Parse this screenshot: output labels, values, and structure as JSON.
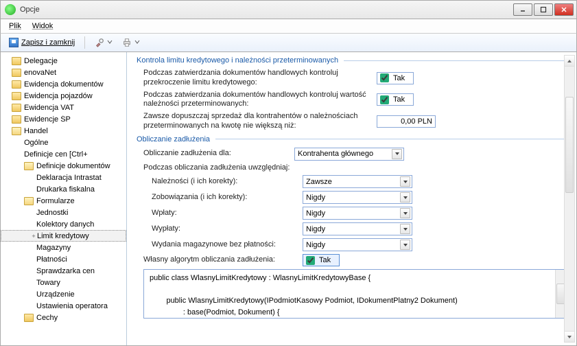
{
  "window": {
    "title": "Opcje"
  },
  "menu": {
    "file": "Plik",
    "view": "Widok"
  },
  "toolbar": {
    "save_close": "Zapisz i zamknij"
  },
  "tree": [
    {
      "label": "Delegacje",
      "depth": 0,
      "folder": true
    },
    {
      "label": "enovaNet",
      "depth": 0,
      "folder": true
    },
    {
      "label": "Ewidencja dokumentów",
      "depth": 0,
      "folder": true
    },
    {
      "label": "Ewidencja pojazdów",
      "depth": 0,
      "folder": true
    },
    {
      "label": "Ewidencja VAT",
      "depth": 0,
      "folder": true
    },
    {
      "label": "Ewidencje ŚP",
      "depth": 0,
      "folder": true
    },
    {
      "label": "Handel",
      "depth": 0,
      "folder": true,
      "open": true
    },
    {
      "label": "Ogólne",
      "depth": 1
    },
    {
      "label": "Definicje cen [Ctrl+",
      "depth": 1
    },
    {
      "label": "Definicje dokumentów",
      "depth": 1,
      "folder": true,
      "open": true
    },
    {
      "label": "Deklaracja Intrastat",
      "depth": 2
    },
    {
      "label": "Drukarka fiskalna",
      "depth": 2
    },
    {
      "label": "Formularze",
      "depth": 1,
      "folder": true,
      "open": true
    },
    {
      "label": "Jednostki",
      "depth": 2
    },
    {
      "label": "Kolektory danych",
      "depth": 2
    },
    {
      "label": "Limit kredytowy",
      "depth": 2,
      "expander": "+",
      "selected": true
    },
    {
      "label": "Magazyny",
      "depth": 2
    },
    {
      "label": "Płatności",
      "depth": 2
    },
    {
      "label": "Sprawdzarka cen",
      "depth": 2
    },
    {
      "label": "Towary",
      "depth": 2
    },
    {
      "label": "Urządzenie",
      "depth": 2
    },
    {
      "label": "Ustawienia operatora",
      "depth": 2
    },
    {
      "label": "Cechy",
      "depth": 1,
      "folder": true
    }
  ],
  "group1": {
    "title": "Kontrola limitu kredytowego i należności przeterminowanych",
    "row1_label": "Podczas zatwierdzania dokumentów handlowych kontroluj przekroczenie limitu kredytowego:",
    "row1_val": "Tak",
    "row2_label": "Podczas zatwierdzania dokumentów handlowych kontroluj wartość należności przeterminowanych:",
    "row2_val": "Tak",
    "row3_label": "Zawsze dopuszczaj sprzedaż dla kontrahentów o należnościach przeterminowanych na kwotę nie większą niż:",
    "row3_val": "0,00 PLN"
  },
  "group2": {
    "title": "Obliczanie zadłużenia",
    "for_label": "Obliczanie zadłużenia dla:",
    "for_val": "Kontrahenta głównego",
    "consider_label": "Podczas obliczania zadłużenia uwzględniaj:",
    "r1l": "Należności (i ich korekty):",
    "r1v": "Zawsze",
    "r2l": "Zobowiązania (i ich korekty):",
    "r2v": "Nigdy",
    "r3l": "Wpłaty:",
    "r3v": "Nigdy",
    "r4l": "Wypłaty:",
    "r4v": "Nigdy",
    "r5l": "Wydania magazynowe bez płatności:",
    "r5v": "Nigdy",
    "own_label": "Własny algorytm obliczania zadłużenia:",
    "own_val": "Tak"
  },
  "code": "public class WlasnyLimitKredytowy : WlasnyLimitKredytowyBase {\n\n        public WlasnyLimitKredytowy(IPodmiotKasowy Podmiot, IDokumentPlatny2 Dokument)\n                : base(Podmiot, Dokument) {\n        }"
}
